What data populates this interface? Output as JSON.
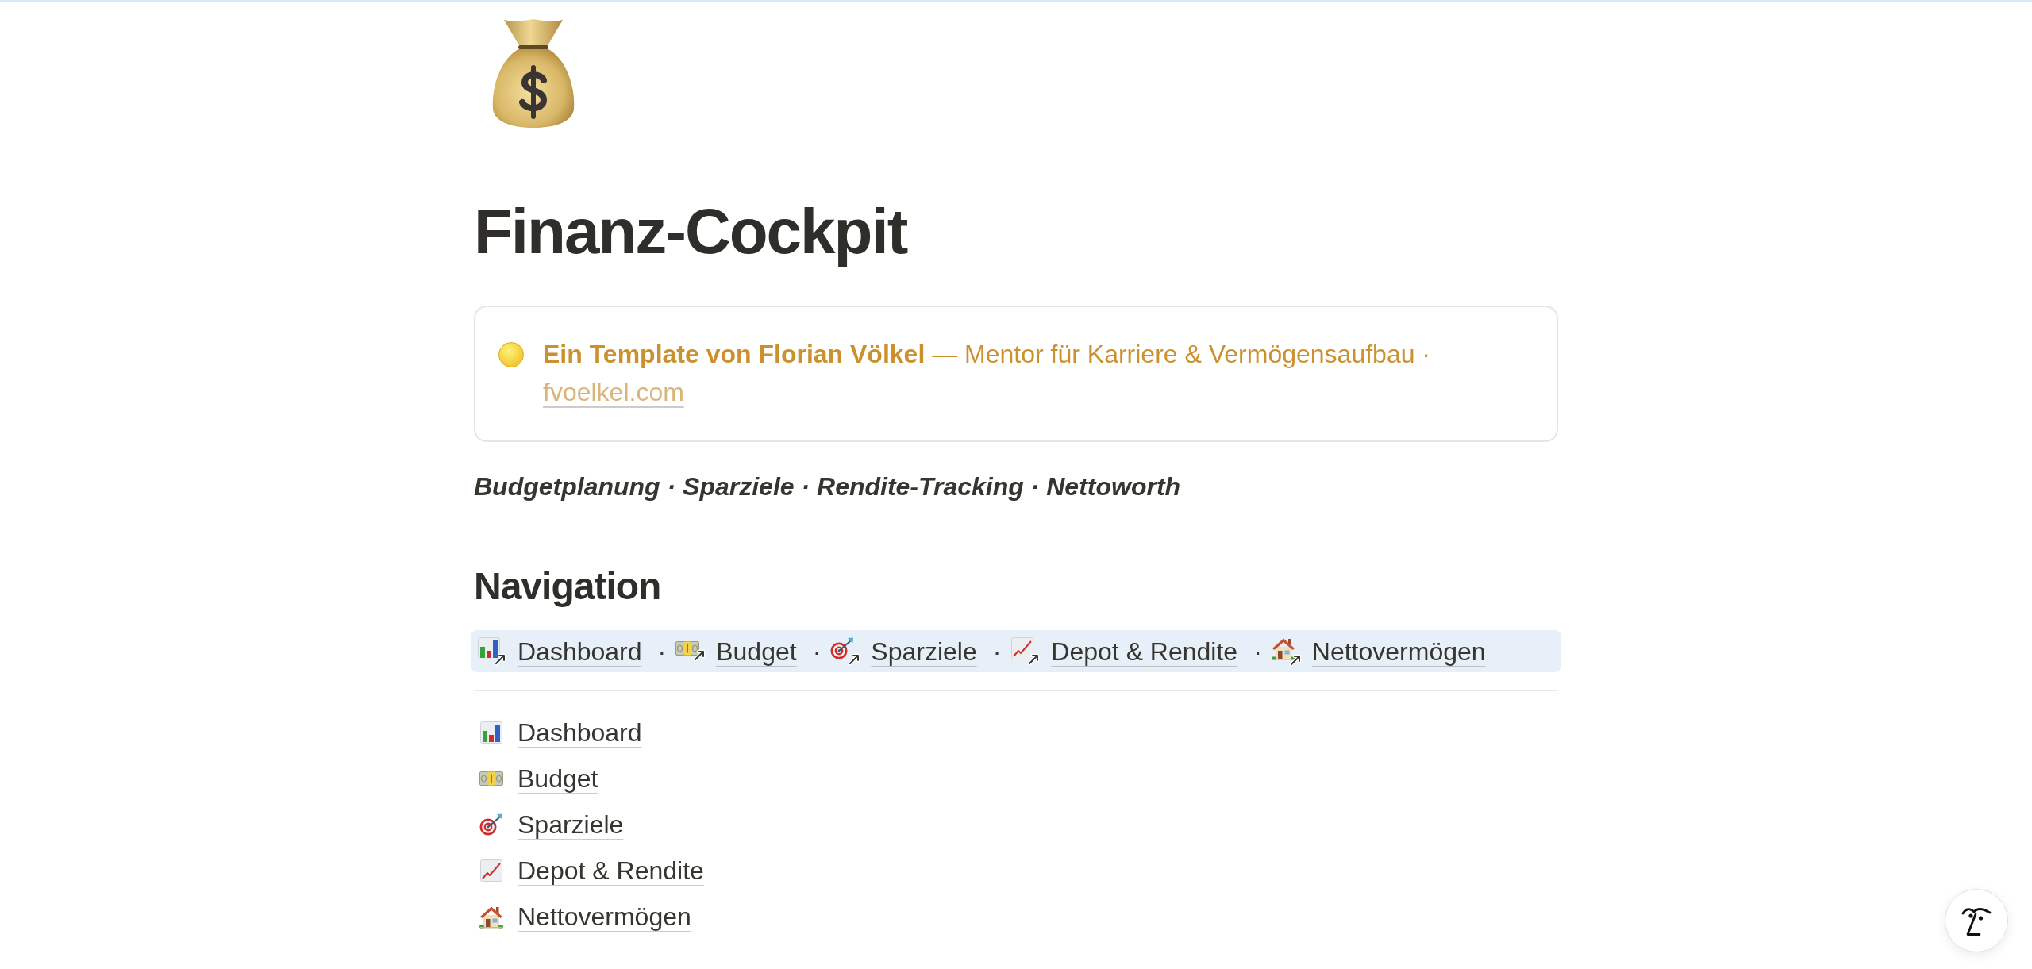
{
  "page_title": "Finanz-Cockpit",
  "callout": {
    "text": "**Ein Template von Florian Völkel** — Mentor für Karriere & Vermögensaufbau ·",
    "link": "fvoelkel.com"
  },
  "subtitle": "Budgetplanung · Sparziele · Rendite-Tracking · Nettoworth",
  "navigation": {
    "heading": "Navigation",
    "bar": [
      {
        "kind": "link",
        "label": "Dashboard"
      },
      {
        "kind": "separator",
        "text": "·"
      },
      {
        "kind": "link",
        "label": "Budget"
      },
      {
        "kind": "separator",
        "text": "·"
      },
      {
        "kind": "link",
        "label": "Sparziele"
      },
      {
        "kind": "separator",
        "text": "·"
      },
      {
        "kind": "link",
        "label": "Depot & Rendite"
      },
      {
        "kind": "separator",
        "text": "·"
      },
      {
        "kind": "link",
        "label": "Nettovermögen"
      }
    ],
    "pages": [
      {
        "label": "Dashboard"
      },
      {
        "label": "Budget"
      },
      {
        "label": "Sparziele"
      },
      {
        "label": "Depot & Rendite"
      },
      {
        "label": "Nettovermögen"
      }
    ]
  }
}
